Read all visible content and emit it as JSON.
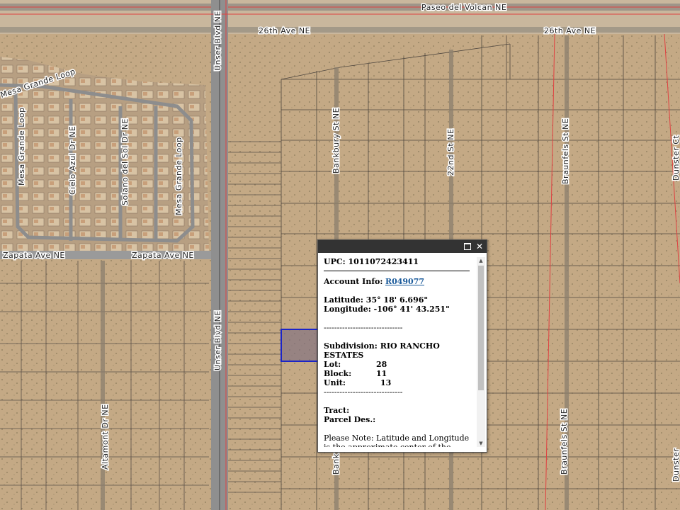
{
  "map": {
    "roads": {
      "paseo": "Paseo del Volcan NE",
      "ave26_left": "26th Ave NE",
      "ave26_right": "26th Ave NE",
      "unser_top": "Unser Blvd NE",
      "unser_bottom": "Unser Blvd NE",
      "mesa_grande_loop_top": "Mesa Grande Loop",
      "mesa_grande_loop_v1": "Mesa Grande Loop",
      "mesa_grande_loop_v2": "Mesa Grande Loop",
      "cielo_azul": "Cielo Azul Dr NE",
      "solano_del_sol": "Solano del Sol Dr NE",
      "zapata_left": "Zapata Ave NE",
      "zapata_right": "Zapata Ave NE",
      "altamont": "Altamont Dr NE",
      "banbury_top": "Bankbury St NE",
      "banbury_bottom": "Bank",
      "st22": "22nd St NE",
      "braunfels_top": "Braunfels St NE",
      "braunfels_bottom": "Braunfels St NE",
      "dunster_top": "Dunster Ct",
      "dunster_bottom": "Dunster"
    },
    "colors": {
      "terrain": "#c7ad8a",
      "parcel_line": "#4a4a4a",
      "selected_parcel": "#1a24c8",
      "road": "#9a9a9a",
      "red_line": "#e04040"
    }
  },
  "popup": {
    "upc_label": "UPC:",
    "upc_value": "1011072423411",
    "account_label": "Account Info:",
    "account_value": "R049077",
    "latitude_label": "Latitude:",
    "latitude_value": "35° 18' 6.696\"",
    "longitude_label": "Longitude:",
    "longitude_value": "-106° 41' 43.251\"",
    "separator": "------------------------------",
    "subdivision_label": "Subdivision:",
    "subdivision_value": "RIO RANCHO ESTATES",
    "lot_label": "Lot:",
    "lot_value": "28",
    "block_label": "Block:",
    "block_value": "11",
    "unit_label": "Unit:",
    "unit_value": "13",
    "tract_label": "Tract:",
    "parcel_des_label": "Parcel Des.:",
    "note": "Please Note: Latitude and Longitude is the approximate center of the parcel shown"
  }
}
